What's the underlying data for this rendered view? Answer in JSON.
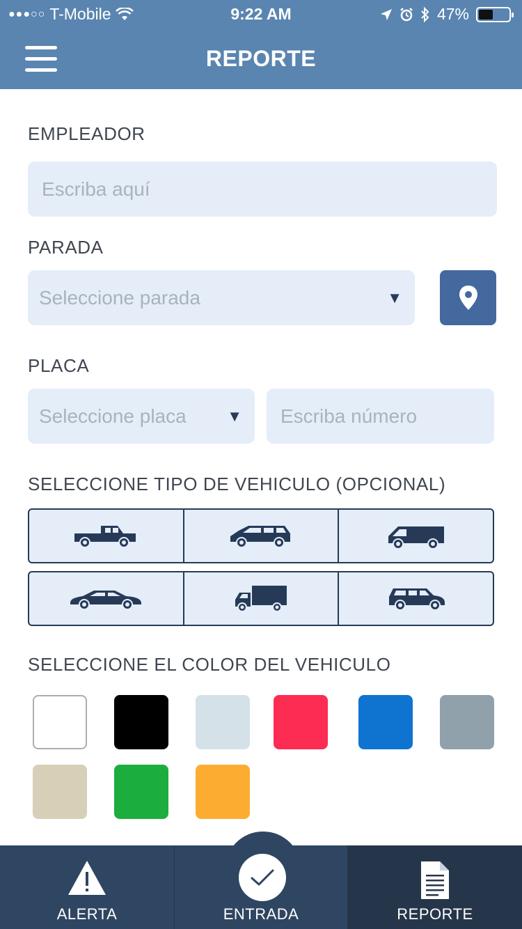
{
  "status": {
    "carrier": "T-Mobile",
    "signal_dots": "●●●○○",
    "time": "9:22 AM",
    "battery": "47%",
    "battery_level": 0.47
  },
  "header": {
    "title": "REPORTE"
  },
  "form": {
    "employer": {
      "label": "EMPLEADOR",
      "placeholder": "Escriba aquí"
    },
    "stop": {
      "label": "PARADA",
      "placeholder": "Seleccione parada"
    },
    "plate": {
      "label": "PLACA",
      "select_placeholder": "Seleccione placa",
      "number_placeholder": "Escriba número"
    },
    "vehicle_type": {
      "label": "SELECCIONE TIPO DE VEHICULO (OPCIONAL)",
      "types": [
        "pickup-truck-icon",
        "minivan-icon",
        "cargo-van-icon",
        "sedan-icon",
        "box-truck-icon",
        "suv-icon"
      ]
    },
    "vehicle_color": {
      "label": "SELECCIONE EL COLOR DEL VEHICULO",
      "colors": [
        "#ffffff",
        "#000000",
        "#d5e1e9",
        "#fc2c52",
        "#0e74cf",
        "#91a1ab",
        "#d8cfb8",
        "#1bae3f",
        "#fdac32"
      ]
    }
  },
  "tabs": [
    {
      "label": "ALERTA",
      "icon": "warning-icon"
    },
    {
      "label": "ENTRADA",
      "icon": "check-icon"
    },
    {
      "label": "REPORTE",
      "icon": "document-icon"
    }
  ]
}
